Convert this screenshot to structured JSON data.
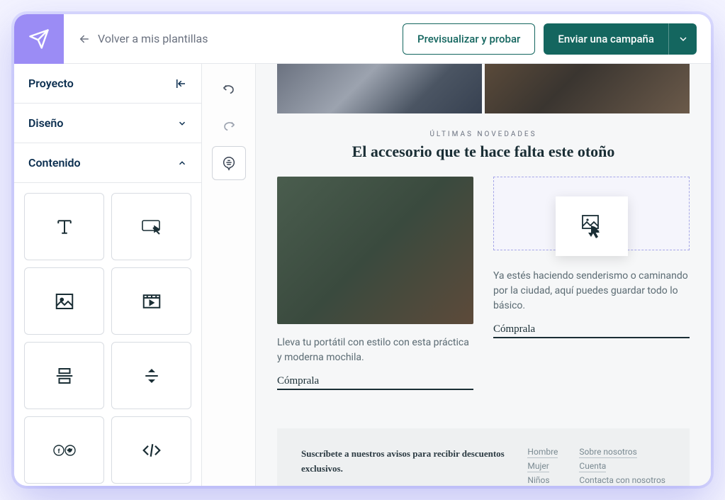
{
  "header": {
    "back_label": "Volver a mis plantillas",
    "preview_label": "Previsualizar y probar",
    "send_label": "Enviar una campaña"
  },
  "sidebar": {
    "project_label": "Proyecto",
    "design_label": "Diseño",
    "content_label": "Contenido"
  },
  "email": {
    "overline": "ÚLTIMAS NOVEDADES",
    "headline": "El accesorio que te hace falta este otoño",
    "left_caption": "Lleva tu portátil con estilo con esta práctica y moderna mochila.",
    "left_cta": "Cómprala",
    "right_caption": "Ya estés haciendo senderismo o caminando por la ciudad, aquí puedes guardar todo lo básico.",
    "right_cta": "Cómprala"
  },
  "footer": {
    "subscribe": "Suscríbete a nuestros avisos para recibir descuentos exclusivos.",
    "col1": [
      "Hombre",
      "Mujer",
      "Niños"
    ],
    "col2": [
      "Sobre nosotros",
      "Cuenta",
      "Contacta con nosotros"
    ]
  }
}
